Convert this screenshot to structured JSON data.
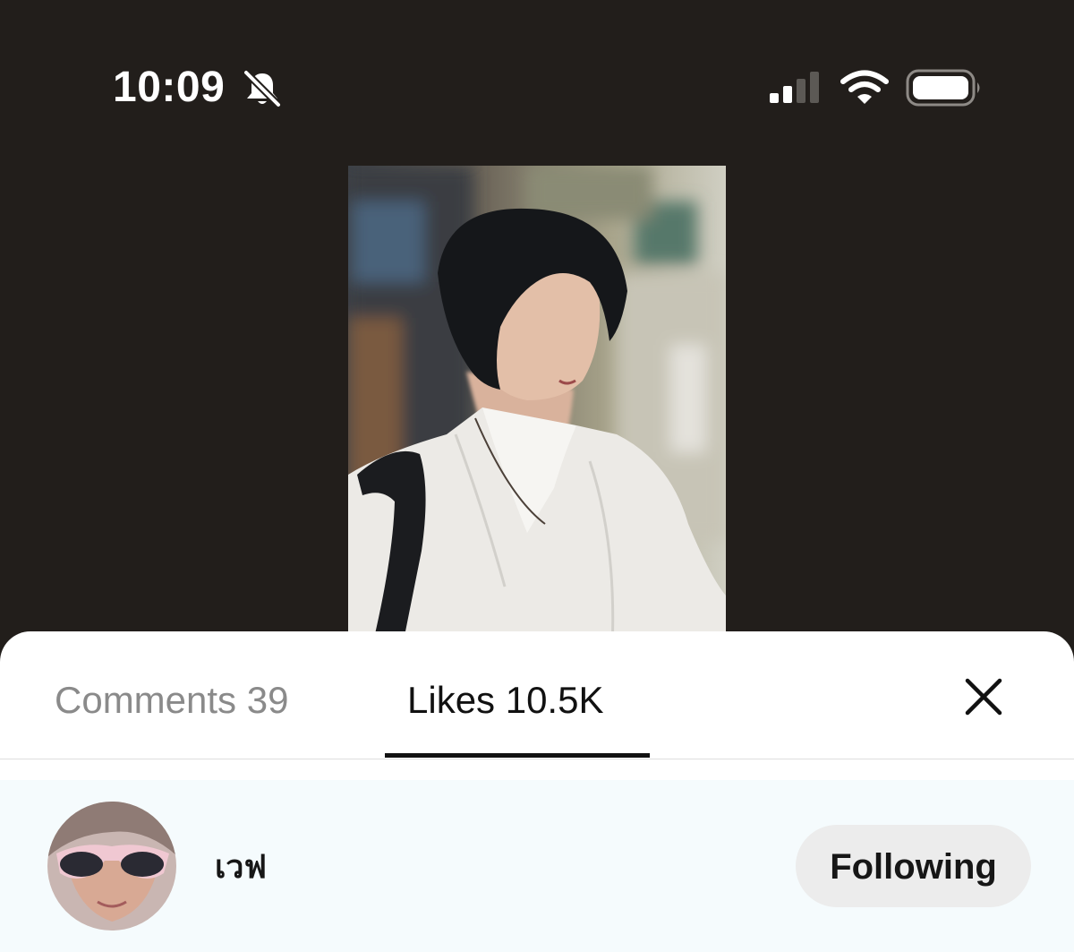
{
  "status_bar": {
    "time": "10:09",
    "icons": [
      "bell-slash-icon",
      "cellular-signal-icon",
      "wifi-icon",
      "battery-icon"
    ]
  },
  "video": {
    "background_color": "#221e1b"
  },
  "sheet": {
    "tabs": [
      {
        "label": "Comments 39",
        "active": false
      },
      {
        "label": "Likes 10.5K",
        "active": true
      }
    ],
    "close_icon": "close-icon",
    "likes": [
      {
        "username": "เวฟ",
        "avatar_icon": "avatar",
        "action_label": "Following"
      }
    ]
  },
  "colors": {
    "sheet_background": "#ffffff",
    "row_highlight": "#f5fbfd",
    "active_tab": "#111111",
    "inactive_tab": "#8a8a8a",
    "button_background": "#ececec"
  }
}
